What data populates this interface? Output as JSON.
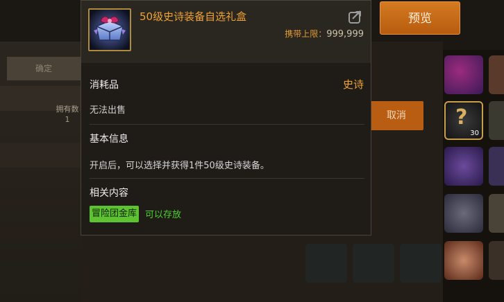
{
  "background": {
    "confirm_label": "确定",
    "owned_label": "拥有数",
    "owned_count": "1",
    "cancel_label": "取消",
    "slot_count": "30"
  },
  "preview_button": {
    "label": "预览"
  },
  "tooltip": {
    "item_name": "50级史诗装备自选礼盒",
    "carry_label": "携带上限：",
    "carry_value": "999,999",
    "category": "消耗品",
    "rarity": "史诗",
    "sell_status": "无法出售",
    "basic_info_title": "基本信息",
    "description": "开启后，可以选择并获得1件50级史诗装备。",
    "related_title": "相关内容",
    "storage_tag": "冒险团金库",
    "storage_status": "可以存放"
  },
  "icons": [
    "gift-box-icon",
    "share-icon"
  ],
  "colors": {
    "rarity_epic": "#f0a334",
    "accent_orange": "#c8691a",
    "storage_green": "#5dc331"
  }
}
